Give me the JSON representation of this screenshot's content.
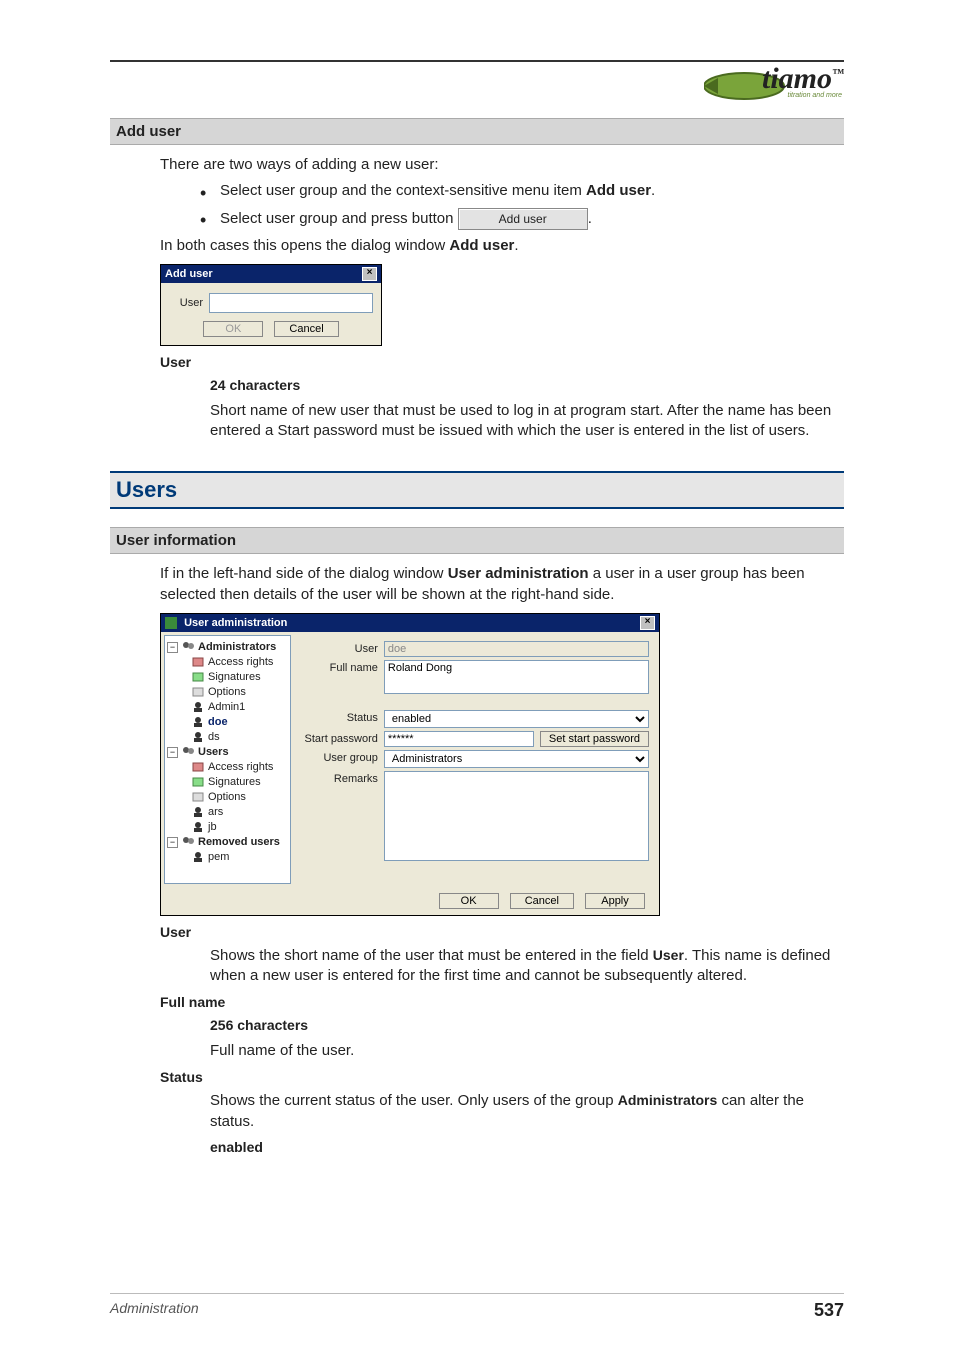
{
  "brand": {
    "name": "tiamo",
    "tagline": "titration and more",
    "tm": "™"
  },
  "section_add_user": {
    "title": "Add user",
    "intro": "There are two ways of adding a new user:",
    "bullet1_pre": "Select user group and the context-sensitive menu item ",
    "bullet1_bold": "Add user",
    "bullet1_post": ".",
    "bullet2_pre": "Select user group and press button ",
    "bullet2_btn": "Add user",
    "bullet2_post": ".",
    "both_pre": "In both cases this opens the dialog window ",
    "both_bold": "Add user",
    "both_post": ".",
    "dialog": {
      "title": "Add user",
      "user_label": "User",
      "user_value": "",
      "ok": "OK",
      "cancel": "Cancel"
    },
    "field_user": {
      "title": "User",
      "limit": "24 characters",
      "desc": "Short name of new user that must be used to log in at program start. After the name has been entered a Start password must be issued with which the user is entered in the list of users."
    }
  },
  "section_users": {
    "title": "Users",
    "subtitle": "User information",
    "intro_pre": "If in the left-hand side of the dialog window ",
    "intro_bold": "User administration",
    "intro_post": " a user in a user group has been selected then details of the user will be shown at the right-hand side.",
    "dialog": {
      "title": "User administration",
      "tree": {
        "administrators": "Administrators",
        "access_rights": "Access rights",
        "signatures": "Signatures",
        "options": "Options",
        "admin1": "Admin1",
        "doe": "doe",
        "ds": "ds",
        "users": "Users",
        "ars": "ars",
        "jb": "jb",
        "removed": "Removed users",
        "pem": "pem"
      },
      "form": {
        "user_label": "User",
        "user_value": "doe",
        "fullname_label": "Full name",
        "fullname_value": "Roland Dong",
        "status_label": "Status",
        "status_value": "enabled",
        "startpw_label": "Start password",
        "startpw_value": "******",
        "setpw_btn": "Set start password",
        "group_label": "User group",
        "group_value": "Administrators",
        "remarks_label": "Remarks",
        "remarks_value": ""
      },
      "ok": "OK",
      "cancel": "Cancel",
      "apply": "Apply"
    },
    "field_user": {
      "title": "User",
      "desc_pre": "Shows the short name of the user that must be entered in the field ",
      "desc_bold": "User",
      "desc_post": ". This name is defined when a new user is entered for the first time and cannot be subsequently altered."
    },
    "field_fullname": {
      "title": "Full name",
      "limit": "256 characters",
      "desc": "Full name of the user."
    },
    "field_status": {
      "title": "Status",
      "desc_pre": "Shows the current status of the user. Only users of the group ",
      "desc_bold": "Administrators",
      "desc_post": " can alter the status.",
      "enabled": "enabled"
    }
  },
  "footer": {
    "left": "Administration",
    "right": "537"
  }
}
